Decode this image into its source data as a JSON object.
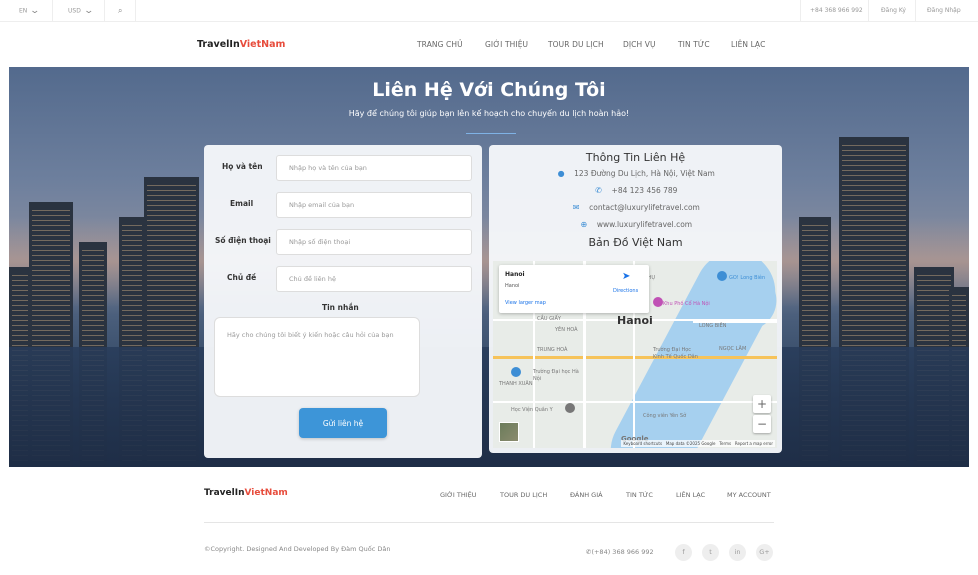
{
  "topbar": {
    "language": "EN",
    "currency": "USD",
    "phone": "+84 368 966 992",
    "register": "Đăng Ký",
    "login": "Đăng Nhập"
  },
  "header": {
    "logo_main": "TravelIn",
    "logo_accent": "VietNam",
    "nav": [
      "TRANG CHỦ",
      "GIỚI THIỆU",
      "TOUR DU LỊCH",
      "DỊCH VỤ",
      "TIN TỨC",
      "LIÊN LẠC"
    ]
  },
  "hero": {
    "title": "Liên Hệ Với Chúng Tôi",
    "subtitle": "Hãy để chúng tôi giúp bạn lên kế hoạch cho chuyến du lịch hoàn hảo!"
  },
  "form": {
    "name_label": "Họ và tên",
    "name_placeholder": "Nhập họ và tên của bạn",
    "email_label": "Email",
    "email_placeholder": "Nhập email của bạn",
    "phone_label": "Số điện thoại",
    "phone_placeholder": "Nhập số điện thoại",
    "subject_label": "Chủ đề",
    "subject_placeholder": "Chủ đề liên hệ",
    "message_label": "Tin nhắn",
    "message_placeholder": "Hãy cho chúng tôi biết ý kiến hoặc câu hỏi của bạn",
    "submit": "Gửi liên hệ"
  },
  "contact_info": {
    "title": "Thông Tin Liên Hệ",
    "address": "123 Đường Du Lịch, Hà Nội, Việt Nam",
    "phone": "+84 123 456 789",
    "email": "contact@luxurylifetravel.com",
    "website": "www.luxurylifetravel.com",
    "map_title": "Bản Đồ Việt Nam"
  },
  "map": {
    "popup_title": "Hanoi",
    "popup_sub": "Hanoi",
    "directions": "Directions",
    "larger_map": "View larger map",
    "city_label": "Hanoi",
    "google": "Google",
    "footer_keyboard": "Keyboard shortcuts",
    "footer_data": "Map data ©2025 Google",
    "footer_terms": "Terms",
    "footer_report": "Report a map error",
    "place_labels": [
      "GO! Long Biên",
      "Khu Phố Cổ Hà Nội",
      "YÊN PHỤ",
      "CẦU GIẤY",
      "LONG BIÊN",
      "YÊN HOÀ",
      "NGỌC LÂM",
      "TRUNG HOÀ",
      "Trường Đại Học Kinh Tế Quốc Dân",
      "Trường Đại học Hà Nội",
      "Học Viện Quân Y",
      "Công viên Yên Sở",
      "THANH XUÂN"
    ]
  },
  "footer": {
    "logo_main": "TravelIn",
    "logo_accent": "VietNam",
    "nav": [
      "GIỚI THIỆU",
      "TOUR DU LỊCH",
      "ĐÁNH GIÁ",
      "TIN TỨC",
      "LIÊN LẠC",
      "MY ACCOUNT"
    ],
    "copyright": "©Copyright. Designed And Developed By Đàm Quốc Dân",
    "phone": "(+84) 368 966 992",
    "social": [
      "f",
      "t",
      "in",
      "G+"
    ]
  },
  "icons": {
    "search": "search-icon",
    "chevron": "chevron-down-icon",
    "location": "map-marker-icon",
    "phone": "phone-icon",
    "email": "envelope-icon",
    "globe": "globe-icon"
  },
  "colors": {
    "accent_red": "#e74c3c",
    "button_blue": "#3d95d8",
    "icon_blue": "#3d8ed5"
  }
}
